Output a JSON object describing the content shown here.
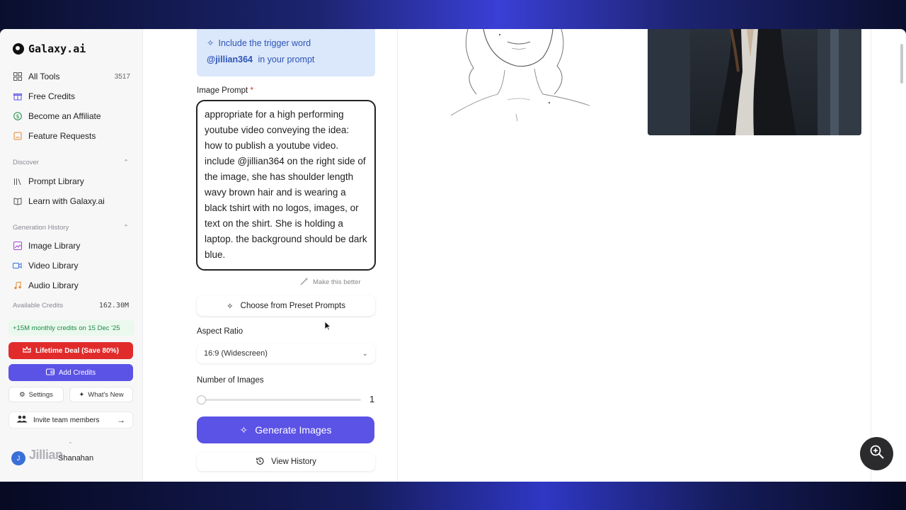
{
  "app": {
    "name": "Galaxy.ai"
  },
  "sidebar": {
    "items": [
      {
        "label": "All Tools",
        "count": "3517",
        "icon": "grid-icon"
      },
      {
        "label": "Free Credits",
        "icon": "gift-icon"
      },
      {
        "label": "Become an Affiliate",
        "icon": "dollar-icon"
      },
      {
        "label": "Feature Requests",
        "icon": "feature-icon"
      }
    ],
    "discover_label": "Discover",
    "discover_items": [
      {
        "label": "Prompt Library",
        "icon": "library-icon"
      },
      {
        "label": "Learn with Galaxy.ai",
        "icon": "book-icon"
      }
    ],
    "history_label": "Generation History",
    "history_items": [
      {
        "label": "Image Library",
        "icon": "image-icon"
      },
      {
        "label": "Video Library",
        "icon": "video-icon"
      },
      {
        "label": "Audio Library",
        "icon": "music-icon"
      }
    ],
    "credits_label": "Available Credits",
    "credits_value": "162.30M",
    "monthly_note": "+15M monthly credits on 15 Dec '25",
    "lifetime_label": "Lifetime Deal (Save 80%)",
    "add_credits_label": "Add Credits",
    "settings_label": "Settings",
    "whats_new_label": "What's New",
    "invite_label": "Invite team members",
    "user_name": "Jillian Shanahan",
    "user_name_visible": "Shanahan",
    "watermark": "Jillian"
  },
  "form": {
    "trigger_line1": "Include the trigger word",
    "trigger_word": "@jillian364",
    "trigger_suffix": "in your prompt",
    "prompt_label": "Image Prompt",
    "prompt_required": "*",
    "prompt_text": "appropriate for a high performing youtube video conveying the idea: how to publish a youtube video. include @jillian364 on the right side of the image, she has shoulder length wavy brown hair and is wearing a black tshirt with no logos, images, or text on the shirt. She is holding a laptop. the background should be dark blue.",
    "make_better_label": "Make this better",
    "preset_label": "Choose from Preset Prompts",
    "aspect_label": "Aspect Ratio",
    "aspect_value": "16:9 (Widescreen)",
    "num_images_label": "Number of Images",
    "num_images_value": "1",
    "num_images_fraction": 0.0,
    "generate_label": "Generate Images",
    "history_label": "View History"
  },
  "colors": {
    "accent": "#5b52e6",
    "danger": "#e12b2b",
    "trigger_bg": "#dbe7fb",
    "trigger_text": "#2d55b5"
  }
}
